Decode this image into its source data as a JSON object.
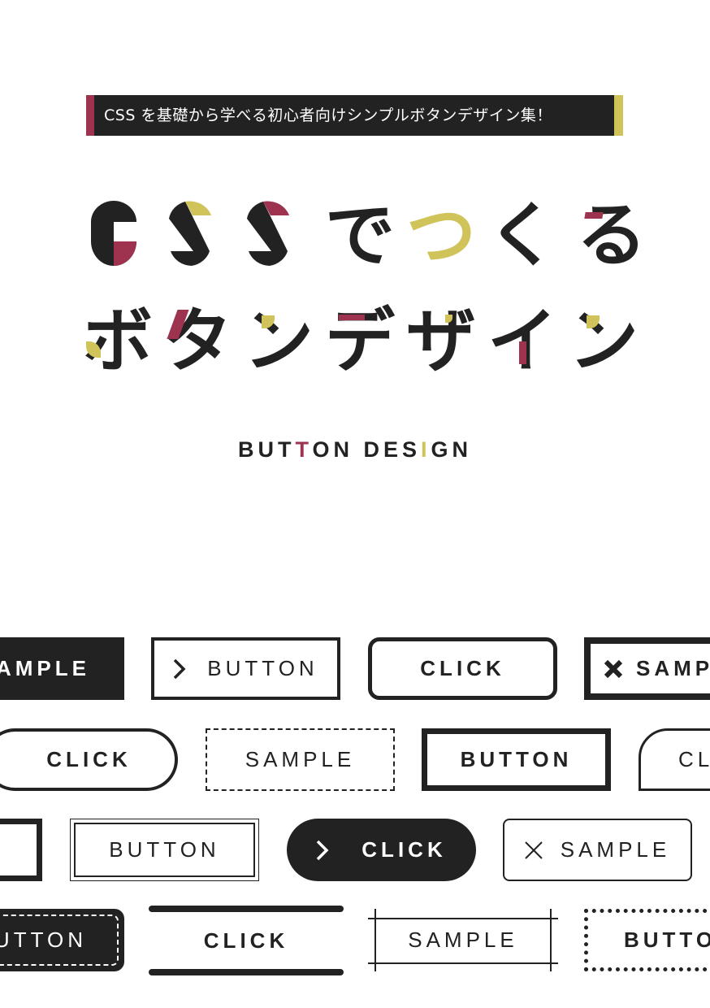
{
  "banner": {
    "text": "CSS を基礎から学べる初心者向けシンプルボタンデザイン集！",
    "accent_left": "#9e3350",
    "accent_right": "#d0c35a",
    "background": "#222222"
  },
  "title": {
    "line1": [
      "C",
      "S",
      "S",
      "で",
      "つ",
      "く",
      "る"
    ],
    "line2": [
      "ボ",
      "タ",
      "ン",
      "デ",
      "ザ",
      "イ",
      "ン"
    ]
  },
  "subtitle": {
    "part1": "BUT",
    "highlight1": "T",
    "part2": "ON DES",
    "highlight2": "I",
    "part3": "GN"
  },
  "colors": {
    "dark": "#222222",
    "crimson": "#9e3350",
    "mustard": "#d0c35a",
    "white": "#ffffff"
  },
  "buttons": [
    {
      "label": "SAMPLE",
      "style": "solid-dark",
      "icon": null
    },
    {
      "label": "BUTTON",
      "style": "outline-square",
      "icon": "chevron-right-icon"
    },
    {
      "label": "CLICK",
      "style": "outline-rounded",
      "icon": null
    },
    {
      "label": "SAMPLE",
      "style": "outline-thick",
      "icon": "close-bold-icon"
    },
    {
      "label": "CLICK",
      "style": "outline-pill",
      "icon": null
    },
    {
      "label": "SAMPLE",
      "style": "dashed",
      "icon": null
    },
    {
      "label": "BUTTON",
      "style": "outline-heavy",
      "icon": null
    },
    {
      "label": "CLICK",
      "style": "outline-corner-rounded",
      "icon": null
    },
    {
      "label": "",
      "style": "outline-heavy",
      "icon": null
    },
    {
      "label": "BUTTON",
      "style": "double-border",
      "icon": null
    },
    {
      "label": "CLICK",
      "style": "solid-pill",
      "icon": "chevron-right-icon"
    },
    {
      "label": "SAMPLE",
      "style": "outline-thin-rounded",
      "icon": "close-thin-icon"
    },
    {
      "label": "BUTTON",
      "style": "solid-stitched",
      "icon": null
    },
    {
      "label": "CLICK",
      "style": "top-bottom-bars",
      "icon": null
    },
    {
      "label": "SAMPLE",
      "style": "crossed-lines",
      "icon": null
    },
    {
      "label": "BUTTON",
      "style": "dotted",
      "icon": null
    }
  ]
}
